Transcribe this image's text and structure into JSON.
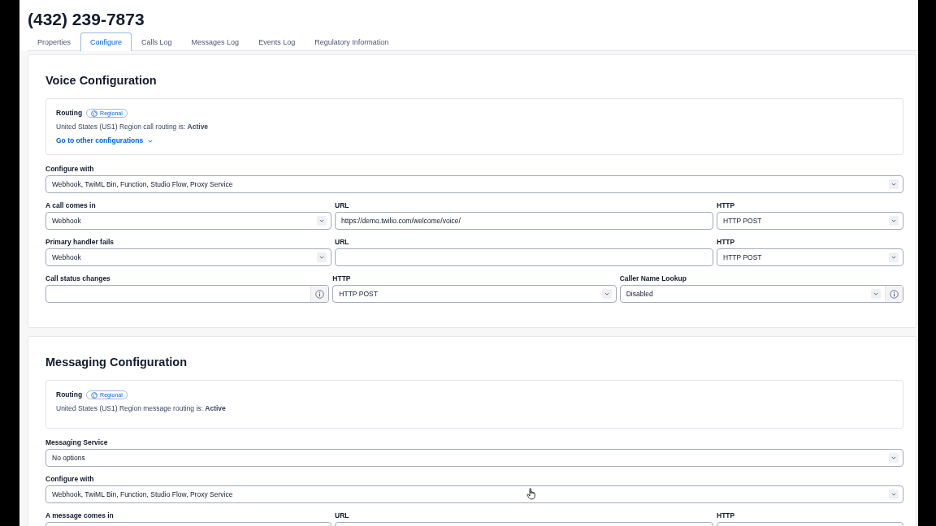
{
  "header": {
    "title": "(432) 239-7873"
  },
  "tabs": [
    {
      "label": "Properties",
      "selected": false
    },
    {
      "label": "Configure",
      "selected": true
    },
    {
      "label": "Calls Log",
      "selected": false
    },
    {
      "label": "Messages Log",
      "selected": false
    },
    {
      "label": "Events Log",
      "selected": false
    },
    {
      "label": "Regulatory Information",
      "selected": false
    }
  ],
  "sections": [
    {
      "title": "Voice Configuration",
      "routing": {
        "label": "Routing",
        "badge": "Regional",
        "status": "United States (US1) Region call routing is: **Active**",
        "link": "Go to other configurations"
      },
      "rows": [
        [
          {
            "kind": "select",
            "label": "Configure with",
            "value": "Webhook, TwiML Bin, Function, Studio Flow, Proxy Service"
          }
        ],
        [
          {
            "kind": "select",
            "label": "A call comes in",
            "value": "Webhook"
          },
          {
            "kind": "text",
            "label": "URL",
            "value": "https://demo.twilio.com/welcome/voice/"
          },
          {
            "kind": "select",
            "label": "HTTP",
            "value": "HTTP POST"
          }
        ],
        [
          {
            "kind": "select",
            "label": "Primary handler fails",
            "value": "Webhook"
          },
          {
            "kind": "text",
            "label": "URL"
          },
          {
            "kind": "select",
            "label": "HTTP",
            "value": "HTTP POST"
          }
        ],
        [
          {
            "kind": "text_info",
            "label": "Call status changes"
          },
          {
            "kind": "select",
            "label": "HTTP",
            "value": "HTTP POST"
          },
          {
            "kind": "select_info",
            "label": "Caller Name Lookup",
            "value": "Disabled"
          }
        ]
      ]
    },
    {
      "title": "Messaging Configuration",
      "routing": {
        "label": "Routing",
        "badge": "Regional",
        "status": "United States (US1) Region message routing is: **Active**"
      },
      "rows": [
        [
          {
            "kind": "select",
            "label": "Messaging Service",
            "value": "No options"
          }
        ],
        [
          {
            "kind": "select",
            "label": "Configure with",
            "value": "Webhook, TwiML Bin, Function, Studio Flow, Proxy Service"
          }
        ],
        [
          {
            "kind": "text",
            "label": "A message comes in"
          },
          {
            "kind": "text",
            "label": "URL"
          },
          {
            "kind": "text",
            "label": "HTTP"
          }
        ]
      ]
    }
  ]
}
